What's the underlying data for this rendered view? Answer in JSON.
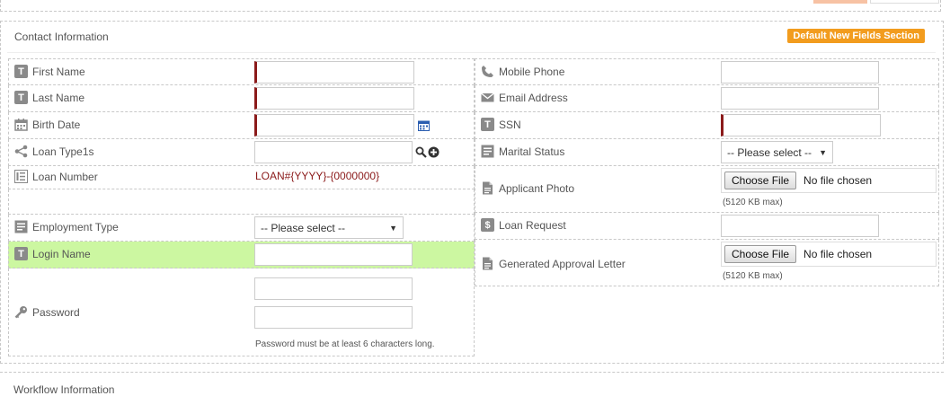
{
  "section": {
    "title": "Contact Information",
    "badge": "Default New Fields Section"
  },
  "left_fields": {
    "first_name": {
      "label": "First Name",
      "icon": "text-field-icon"
    },
    "last_name": {
      "label": "Last Name",
      "icon": "text-field-icon"
    },
    "birth_date": {
      "label": "Birth Date",
      "icon": "calendar-icon"
    },
    "loan_type": {
      "label": "Loan Type1s",
      "icon": "share-icon"
    },
    "loan_number": {
      "label": "Loan Number",
      "value": "LOAN#{YYYY}-{0000000}",
      "icon": "number-list-icon"
    },
    "employment_type": {
      "label": "Employment Type",
      "selected": "-- Please select --",
      "icon": "list-icon"
    },
    "login_name": {
      "label": "Login Name",
      "icon": "text-field-icon"
    },
    "password": {
      "label": "Password",
      "hint": "Password must be at least 6 characters long.",
      "icon": "key-icon"
    }
  },
  "right_fields": {
    "mobile_phone": {
      "label": "Mobile Phone",
      "icon": "phone-icon"
    },
    "email_address": {
      "label": "Email Address",
      "icon": "envelope-icon"
    },
    "ssn": {
      "label": "SSN",
      "icon": "text-field-icon"
    },
    "marital_status": {
      "label": "Marital Status",
      "selected": "-- Please select --",
      "icon": "list-icon"
    },
    "applicant_photo": {
      "label": "Applicant Photo",
      "button": "Choose File",
      "file_status": "No file chosen",
      "hint": "(5120 KB max)",
      "icon": "document-icon"
    },
    "loan_request": {
      "label": "Loan Request",
      "icon": "dollar-icon"
    },
    "approval_letter": {
      "label": "Generated Approval Letter",
      "button": "Choose File",
      "file_status": "No file chosen",
      "hint": "(5120 KB max)",
      "icon": "document-icon"
    }
  },
  "next_section": {
    "title": "Workflow Information"
  },
  "colors": {
    "required": "#8b1a1a",
    "badge": "#f29c1e",
    "highlight": "#ccf7a1"
  }
}
